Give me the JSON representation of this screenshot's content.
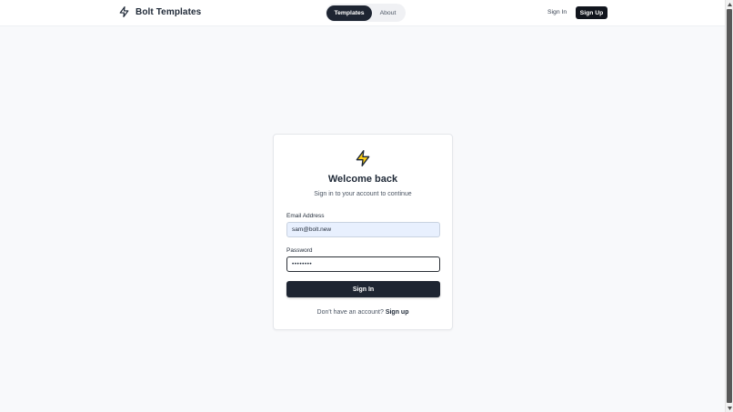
{
  "nav": {
    "brand": "Bolt Templates",
    "tabs": [
      {
        "label": "Templates",
        "active": true
      },
      {
        "label": "About",
        "active": false
      }
    ],
    "signin_label": "Sign In",
    "signup_label": "Sign Up"
  },
  "card": {
    "icon": "lightning-bolt-icon",
    "title": "Welcome back",
    "subtitle": "Sign in to your account to continue",
    "email_label": "Email Address",
    "email_value": "sam@bolt.new",
    "password_label": "Password",
    "password_value": "••••••••",
    "submit_label": "Sign In",
    "footer_text": "Don't have an account?",
    "footer_link": "Sign up"
  },
  "colors": {
    "accent": "#1e2532",
    "bolt_fill": "#facc15",
    "background": "#f8f9fb"
  }
}
